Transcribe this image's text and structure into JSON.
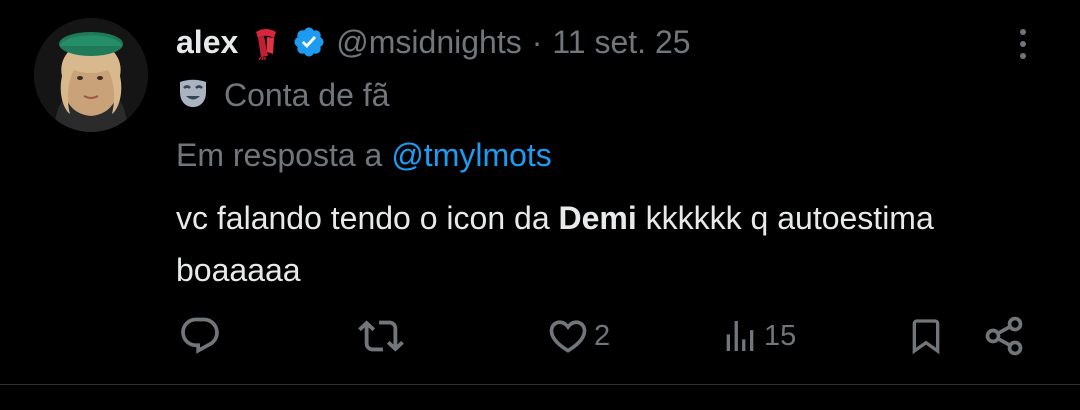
{
  "colors": {
    "background": "#000000",
    "text": "#e7e9ea",
    "secondary": "#71767b",
    "link": "#1d9bf0",
    "verified": "#1d9bf0",
    "divider": "#2f3336"
  },
  "tweet": {
    "author_name": "alex",
    "author_emoji": "scarf-icon",
    "verified_icon": "verified-badge-icon",
    "handle": "@msidnights",
    "separator": "·",
    "timestamp": "11 set. 25",
    "label_icon": "theater-mask-icon",
    "label": "Conta de fã",
    "reply_prefix": "Em resposta a",
    "reply_to": "@tmylmots",
    "text_before": "vc falando tendo o icon da ",
    "text_bold": "Demi",
    "text_after": " kkkkkk q autoestima boaaaaa"
  },
  "actions": {
    "reply_count": "",
    "retweet_count": "",
    "like_count": "2",
    "views_count": "15"
  }
}
